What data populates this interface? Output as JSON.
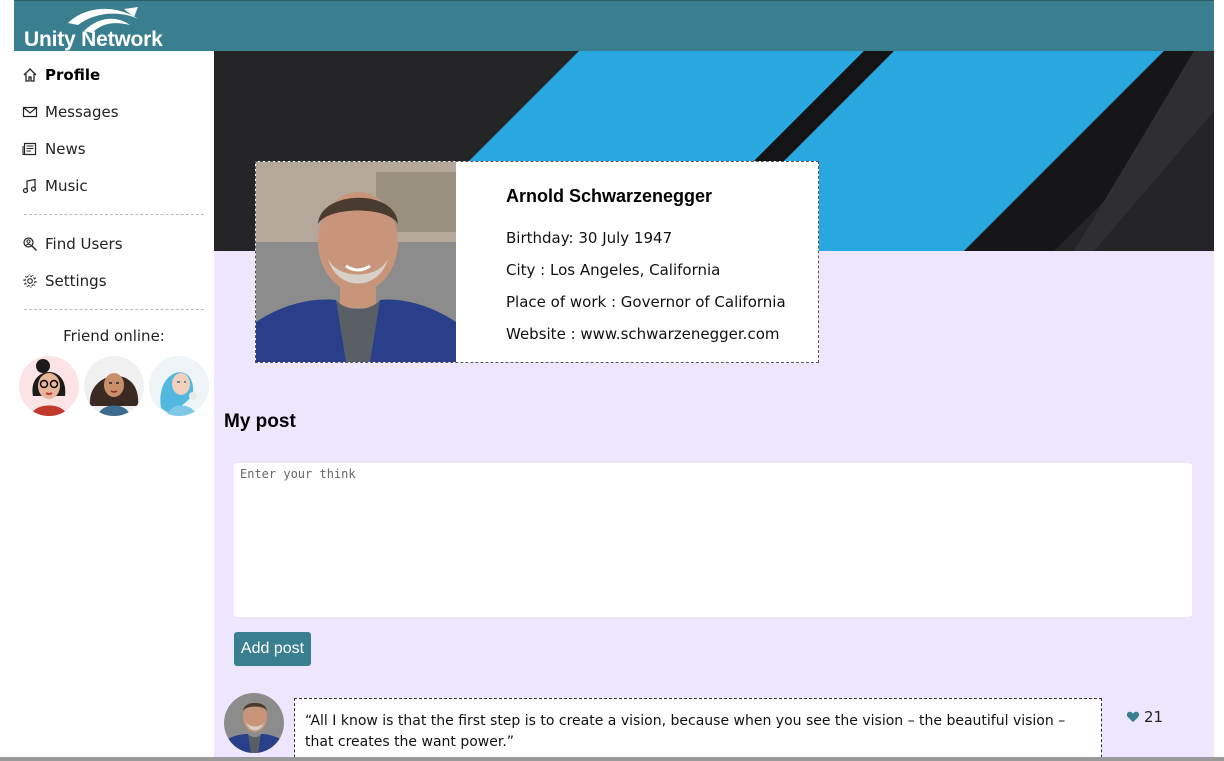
{
  "app": {
    "name": "Unity Network"
  },
  "nav": {
    "items": [
      {
        "label": "Profile",
        "icon": "home-icon",
        "active": true
      },
      {
        "label": "Messages",
        "icon": "envelope-icon",
        "active": false
      },
      {
        "label": "News",
        "icon": "newspaper-icon",
        "active": false
      },
      {
        "label": "Music",
        "icon": "music-note-icon",
        "active": false
      },
      {
        "label": "Find Users",
        "icon": "user-search-icon",
        "active": false
      },
      {
        "label": "Settings",
        "icon": "gear-icon",
        "active": false
      }
    ]
  },
  "friends": {
    "title": "Friend online:"
  },
  "profile": {
    "name": "Arnold Schwarzenegger",
    "birthday": "Birthday: 30 July 1947",
    "city": "City : Los Angeles, California",
    "work": "Place of work : Governor of California",
    "website": "Website : www.schwarzenegger.com"
  },
  "posts_section": {
    "title": "My post",
    "placeholder": "Enter your think",
    "add_label": "Add post"
  },
  "posts": [
    {
      "text": "“All I know is that the first step is to create a vision, because when you see the vision – the beautiful vision – that creates the want power.”",
      "likes": "21"
    }
  ],
  "colors": {
    "accent": "#3a7f8f",
    "main_bg": "#eee6fd",
    "banner_blue": "#29a8e0",
    "banner_dark": "#252527"
  }
}
